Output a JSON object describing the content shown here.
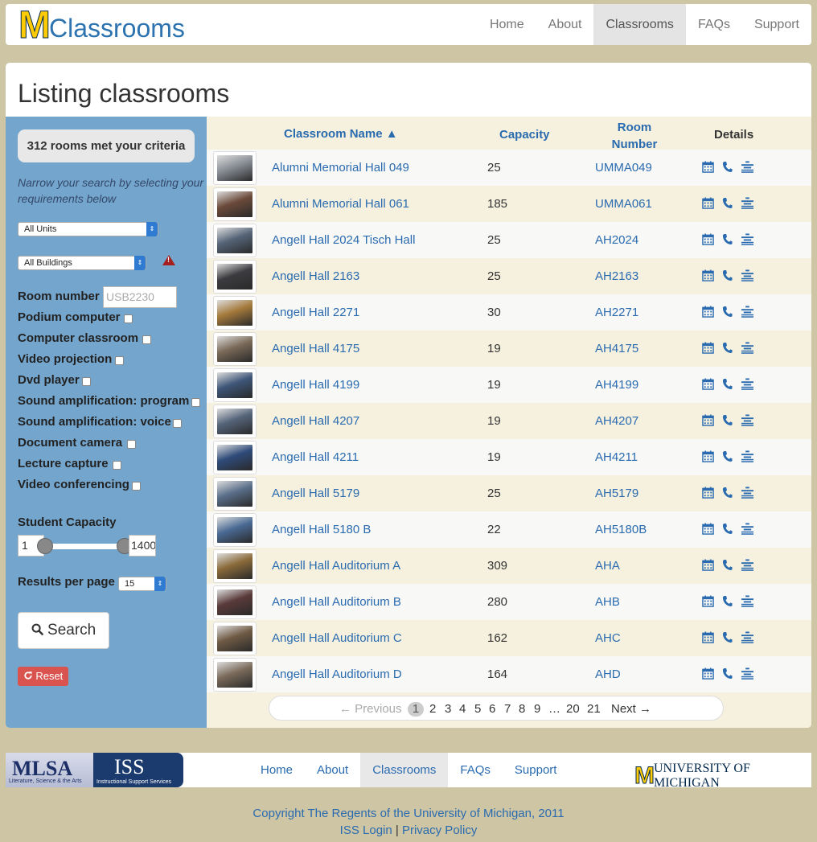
{
  "brand": {
    "m": "M",
    "text": "Classrooms"
  },
  "nav": {
    "items": [
      "Home",
      "About",
      "Classrooms",
      "FAQs",
      "Support"
    ],
    "active": "Classrooms"
  },
  "page_title": "Listing classrooms",
  "sidebar": {
    "criteria": "312 rooms met your criteria",
    "narrow_text": "Narrow your search by selecting your requirements below",
    "units_select": "All Units",
    "buildings_select": "All Buildings",
    "room_number_label": "Room number",
    "room_number_placeholder": "USB2230",
    "features": [
      "Podium computer",
      "Computer classroom",
      "Video projection",
      "Dvd player",
      "Sound amplification: program",
      "Sound amplification: voice",
      "Document camera",
      "Lecture capture",
      "Video conferencing"
    ],
    "capacity_label": "Student Capacity",
    "capacity_min": "1",
    "capacity_max": "1400",
    "results_label": "Results per page",
    "results_value": "15",
    "search_label": "Search",
    "reset_label": "Reset"
  },
  "table": {
    "headers": {
      "name": "Classroom Name ▲",
      "capacity": "Capacity",
      "room_number": "Room Number",
      "details": "Details"
    },
    "rows": [
      {
        "name": "Alumni Memorial Hall 049",
        "capacity": "25",
        "room": "UMMA049",
        "thumb": "#8a8f96"
      },
      {
        "name": "Alumni Memorial Hall 061",
        "capacity": "185",
        "room": "UMMA061",
        "thumb": "#6b4a3a"
      },
      {
        "name": "Angell Hall 2024 Tisch Hall",
        "capacity": "25",
        "room": "AH2024",
        "thumb": "#556478"
      },
      {
        "name": "Angell Hall 2163",
        "capacity": "25",
        "room": "AH2163",
        "thumb": "#3c3c40"
      },
      {
        "name": "Angell Hall 2271",
        "capacity": "30",
        "room": "AH2271",
        "thumb": "#a57a3c"
      },
      {
        "name": "Angell Hall 4175",
        "capacity": "19",
        "room": "AH4175",
        "thumb": "#7a6a58"
      },
      {
        "name": "Angell Hall 4199",
        "capacity": "19",
        "room": "AH4199",
        "thumb": "#3e5678"
      },
      {
        "name": "Angell Hall 4207",
        "capacity": "19",
        "room": "AH4207",
        "thumb": "#55647a"
      },
      {
        "name": "Angell Hall 4211",
        "capacity": "19",
        "room": "AH4211",
        "thumb": "#2f4b7a"
      },
      {
        "name": "Angell Hall 5179",
        "capacity": "25",
        "room": "AH5179",
        "thumb": "#5a6f8a"
      },
      {
        "name": "Angell Hall 5180 B",
        "capacity": "22",
        "room": "AH5180B",
        "thumb": "#4a6a94"
      },
      {
        "name": "Angell Hall Auditorium A",
        "capacity": "309",
        "room": "AHA",
        "thumb": "#8a6a3a"
      },
      {
        "name": "Angell Hall Auditorium B",
        "capacity": "280",
        "room": "AHB",
        "thumb": "#5a3a3a"
      },
      {
        "name": "Angell Hall Auditorium C",
        "capacity": "162",
        "room": "AHC",
        "thumb": "#6f5a44"
      },
      {
        "name": "Angell Hall Auditorium D",
        "capacity": "164",
        "room": "AHD",
        "thumb": "#7a6a5a"
      }
    ]
  },
  "pagination": {
    "previous": "← Previous",
    "current": "1",
    "pages": [
      "2",
      "3",
      "4",
      "5",
      "6",
      "7",
      "8",
      "9",
      "…",
      "20",
      "21"
    ],
    "next": "Next →"
  },
  "footer": {
    "lsa_big": "MLSA",
    "lsa_small": "Literature, Science & the Arts",
    "iss_big": "ISS",
    "iss_small": "Instructional Support Services",
    "nav": [
      "Home",
      "About",
      "Classrooms",
      "FAQs",
      "Support"
    ],
    "active": "Classrooms",
    "um_m": "M",
    "um_text": "UNIVERSITY OF MICHIGAN",
    "copyright": "Copyright The Regents of the University of Michigan, 2011",
    "iss_login": "ISS Login",
    "separator": "|",
    "privacy": "Privacy Policy"
  },
  "colors": {
    "accent_link": "#2a6bb0",
    "sidebar_bg": "#74a5cd",
    "table_bg": "#f6f1de",
    "reset_red": "#d9534f",
    "page_bg": "#cdc5a3"
  }
}
